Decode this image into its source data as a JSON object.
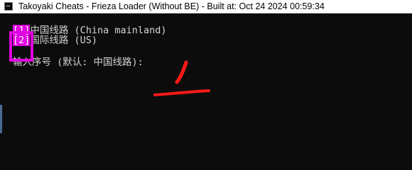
{
  "window": {
    "title": "Takoyaki Cheats - Frieza Loader (Without BE) - Built at:  Oct 24 2024 00:59:34"
  },
  "console": {
    "options": [
      {
        "index": "[1]",
        "label": "中国线路 (China mainland)"
      },
      {
        "index": "[2]",
        "label": "国际线路 (US)"
      }
    ],
    "prompt": "输入序号 (默认: 中国线路): "
  },
  "annotation": {
    "color": "#ff1a1a",
    "highlight_color": "#e100e1"
  }
}
